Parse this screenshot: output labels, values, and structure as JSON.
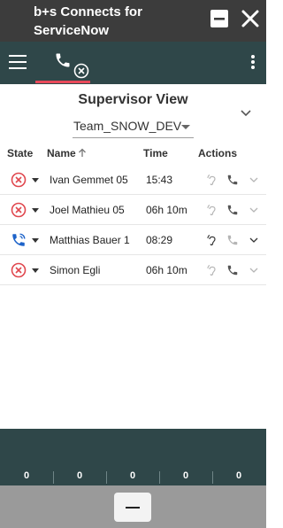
{
  "window": {
    "title": "b+s Connects for ServiceNow"
  },
  "supervisor": {
    "title": "Supervisor View",
    "team": "Team_SNOW_DEV"
  },
  "table": {
    "headers": {
      "state": "State",
      "name": "Name",
      "time": "Time",
      "actions": "Actions"
    },
    "rows": [
      {
        "state": "not-ready",
        "name": "Ivan Gemmet 05",
        "time": "15:43"
      },
      {
        "state": "not-ready",
        "name": "Joel Mathieu 05",
        "time": "06h 10m"
      },
      {
        "state": "on-call",
        "name": "Matthias Bauer 1",
        "time": "08:29"
      },
      {
        "state": "not-ready",
        "name": "Simon Egli",
        "time": "06h 10m"
      }
    ]
  },
  "stats": {
    "counts": [
      "0",
      "0",
      "0",
      "0",
      "0"
    ]
  },
  "colors": {
    "toolbar": "#2f4749",
    "accent_underline": "#e8495a",
    "not_ready": "#e0474e",
    "on_call": "#1d63c9"
  },
  "icons": {
    "menu": "hamburger-icon",
    "phone": "phone-icon",
    "more": "more-vert-icon",
    "listen": "ear-icon",
    "call": "phone-icon",
    "expand": "chevron-down-icon"
  }
}
